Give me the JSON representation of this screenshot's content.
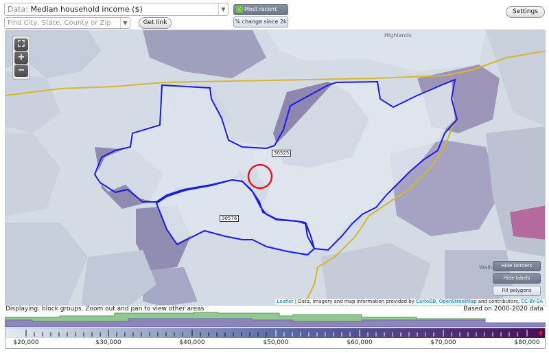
{
  "controls": {
    "data_prefix": "Data:",
    "data_value": "Median household income ($)",
    "search_placeholder": "Find City, State, County or Zip Code",
    "get_link": "Get link",
    "toggle_recent": "Most recent value",
    "toggle_change": "% change since 2k",
    "settings": "Settings"
  },
  "map": {
    "zoom_in": "+",
    "zoom_out": "−",
    "zip_labels": [
      "30525",
      "30576"
    ],
    "place_labels": [
      "Highlands",
      "Walh"
    ],
    "buttons": [
      "Hide borders",
      "Hide labels",
      "Fill polygons"
    ],
    "attribution": {
      "leaflet": "Leaflet",
      "text": " | Data, imagery and map information provided by ",
      "carto": "CartoDB",
      "sep": ", ",
      "osm": "OpenStreetMap",
      "rest": " and contributors, ",
      "license": "CC-BY-SA"
    },
    "colors": {
      "state_border": "#d9b52a",
      "zip_border": "#1a1ae6",
      "marker": "#e8141c",
      "high": "#b56c9e",
      "mid": "#8c86ae",
      "low": "#dfe6ee"
    }
  },
  "footer": {
    "displaying": "Displaying: block groups. Zoom out and pan to view other areas",
    "based_on": "Based on 2000-2020 data"
  },
  "scale": {
    "labels": [
      "$20,000",
      "$30,000",
      "$40,000",
      "$50,000",
      "$60,000",
      "$70,000",
      "$80,000"
    ],
    "colors": {
      "start": "#e4ebf0",
      "mid": "#5a6ea8",
      "end": "#4a0e5a"
    }
  }
}
